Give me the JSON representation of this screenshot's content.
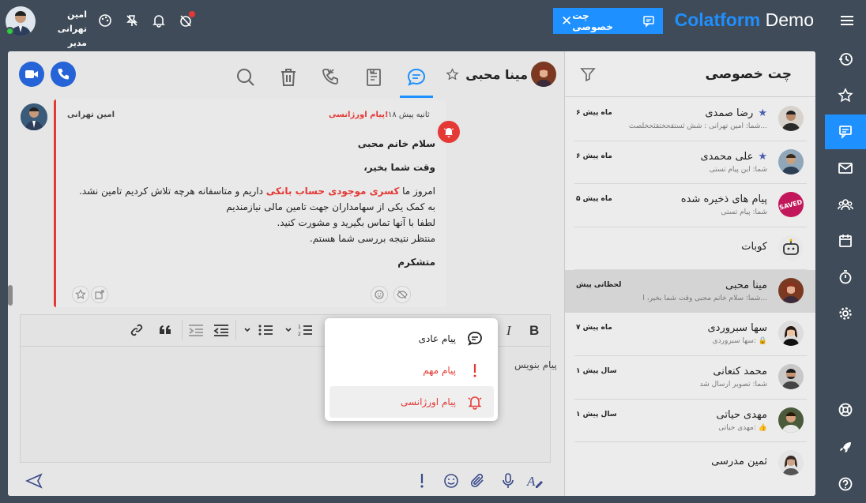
{
  "header": {
    "brand_part1": "Colatform",
    "brand_part2": " Demo",
    "chip_label": "چت خصوصی",
    "chip_close": "✕",
    "user_name": "امین تهرانی",
    "user_role": "مدیر عامل"
  },
  "colors": {
    "accent": "#1e90ff",
    "urgent": "#e53935",
    "sidebar": "#3f4b58"
  },
  "nav": {
    "items": [
      "history-icon",
      "star-icon",
      "chat-icon",
      "mail-icon",
      "users-icon",
      "calendar-icon",
      "timer-icon",
      "settings-icon",
      "support-icon",
      "rocket-icon",
      "help-icon"
    ],
    "active": "chat-icon"
  },
  "list": {
    "title": "چت خصوصی",
    "conversations": [
      {
        "name": "رضا صمدی",
        "preview": "شما: امین تهرانی : شش ثستقحختقثحخلصث...",
        "time": "۶ ماه پیش",
        "starred": true
      },
      {
        "name": "علی محمدی",
        "preview": "شما: این پیام تستی",
        "time": "۶ ماه پیش",
        "starred": true
      },
      {
        "name": "پیام های ذخیره شده",
        "preview": "شما: پیام تستی",
        "time": "۵ ماه پیش",
        "starred": false,
        "badge": "SAVED"
      },
      {
        "name": "کوبات",
        "preview": "",
        "time": "",
        "starred": false
      },
      {
        "name": "مینا محبی",
        "preview": "شما: سلام خانم محبی وقت شما بخیر، ا...",
        "time": "لحظاتی پیش",
        "starred": false,
        "selected": true
      },
      {
        "name": "سها سبروردی",
        "preview": "سها سبروردی: 🔒",
        "time": "۷ ماه پیش",
        "starred": false
      },
      {
        "name": "محمد کنعانی",
        "preview": "شما: تصویر ارسال شد",
        "time": "۱ سال پیش",
        "starred": false
      },
      {
        "name": "مهدی حیاتی",
        "preview": "مهدی حیاتی: 👍",
        "time": "۱ سال پیش",
        "starred": false
      },
      {
        "name": "ثمین مدرسی",
        "preview": "",
        "time": "",
        "starred": false
      }
    ]
  },
  "chat": {
    "contact_name": "مینا محبی",
    "message": {
      "sender": "امین تهرانی",
      "time": "۱۸ ثانیه پیش",
      "tag": "پیام اورژانسی!",
      "greeting": "سلام خانم محبی",
      "line2": "وقت شما بخیر،",
      "line3_pre": "امروز ما ",
      "line3_red": "کسری موجودی حساب بانکی",
      "line3_post": " داریم و متاسفانه هرچه تلاش کردیم تامین نشد.",
      "line4": "به کمک یکی از سهامداران جهت تامین مالی نیازمندیم",
      "line5": "لطفا با آنها تماس بگیرید و مشورت کنید.",
      "line6": "منتظر نتیجه بررسی شما هستم.",
      "signoff": "متشکرم"
    },
    "editor_placeholder": "پیام بنویس"
  },
  "popup": {
    "options": [
      {
        "label": "پیام عادی",
        "color": "#222"
      },
      {
        "label": "پیام مهم",
        "color": "#e53935"
      },
      {
        "label": "پیام اورژانسی",
        "color": "#e53935"
      }
    ]
  }
}
